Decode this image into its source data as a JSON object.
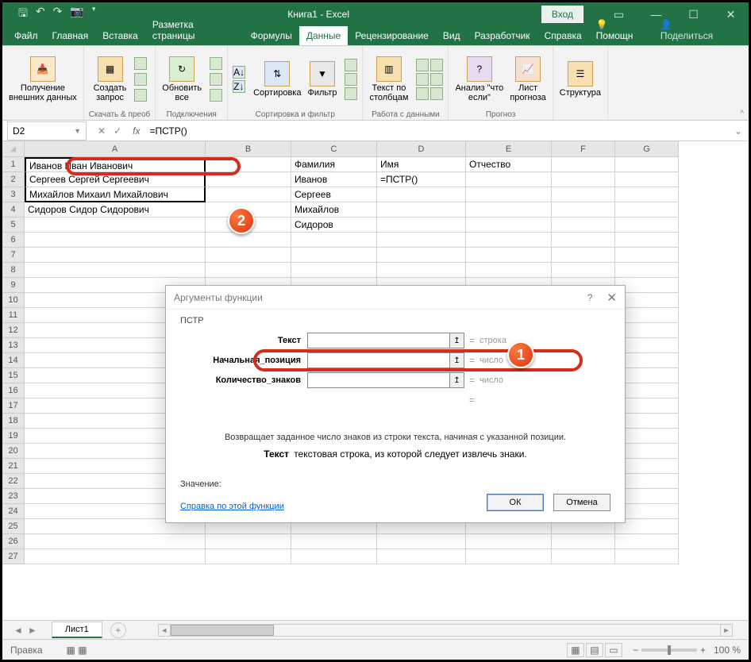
{
  "window": {
    "title": "Книга1  -  Excel",
    "login": "Вход"
  },
  "tabs": {
    "items": [
      "Файл",
      "Главная",
      "Вставка",
      "Разметка страницы",
      "Формулы",
      "Данные",
      "Рецензирование",
      "Вид",
      "Разработчик",
      "Справка"
    ],
    "tell_me": "Помощн",
    "share": "Поделиться",
    "active": "Данные"
  },
  "ribbon": {
    "g0": {
      "big": "Получение\nвнешних данных"
    },
    "g1": {
      "big": "Создать\nзапрос",
      "lbl": "Скачать & преоб"
    },
    "g2": {
      "big": "Обновить\nвсе",
      "lbl": "Подключения"
    },
    "g3": {
      "b1": "Сортировка",
      "b2": "Фильтр",
      "lbl": "Сортировка и фильтр"
    },
    "g4": {
      "big": "Текст по\nстолбцам",
      "lbl": "Работа с данными"
    },
    "g5": {
      "b1": "Анализ \"что\nесли\"",
      "b2": "Лист\nпрогноза",
      "lbl": "Прогноз"
    },
    "g6": {
      "big": "Структура"
    }
  },
  "namebox": "D2",
  "formula": "=ПСТР()",
  "columns": [
    "A",
    "B",
    "C",
    "D",
    "E",
    "F",
    "G"
  ],
  "rows_count": 27,
  "data": {
    "A1": "Иванов Иван Иванович",
    "A2": "Сергеев Сергей Сергеевич",
    "A3": "Михайлов Михаил Михайлович",
    "A4": "Сидоров Сидор Сидорович",
    "C1": "Фамилия",
    "D1": "Имя",
    "E1": "Отчество",
    "C2": "Иванов",
    "D2": "=ПСТР()",
    "C3": "Сергеев",
    "C4": "Михайлов",
    "C5": "Сидоров"
  },
  "dialog": {
    "title": "Аргументы функции",
    "func": "ПСТР",
    "args": [
      {
        "label": "Текст",
        "val": "строка"
      },
      {
        "label": "Начальная_позиция",
        "val": "число"
      },
      {
        "label": "Количество_знаков",
        "val": "число"
      }
    ],
    "desc": "Возвращает заданное число знаков из строки текста, начиная с указанной позиции.",
    "arg_name": "Текст",
    "arg_desc": "текстовая строка, из которой следует извлечь знаки.",
    "value_label": "Значение:",
    "help": "Справка по этой функции",
    "ok": "ОК",
    "cancel": "Отмена"
  },
  "sheet": {
    "name": "Лист1"
  },
  "status": {
    "left": "Правка",
    "zoom": "100 %"
  },
  "badges": {
    "one": "1",
    "two": "2"
  }
}
